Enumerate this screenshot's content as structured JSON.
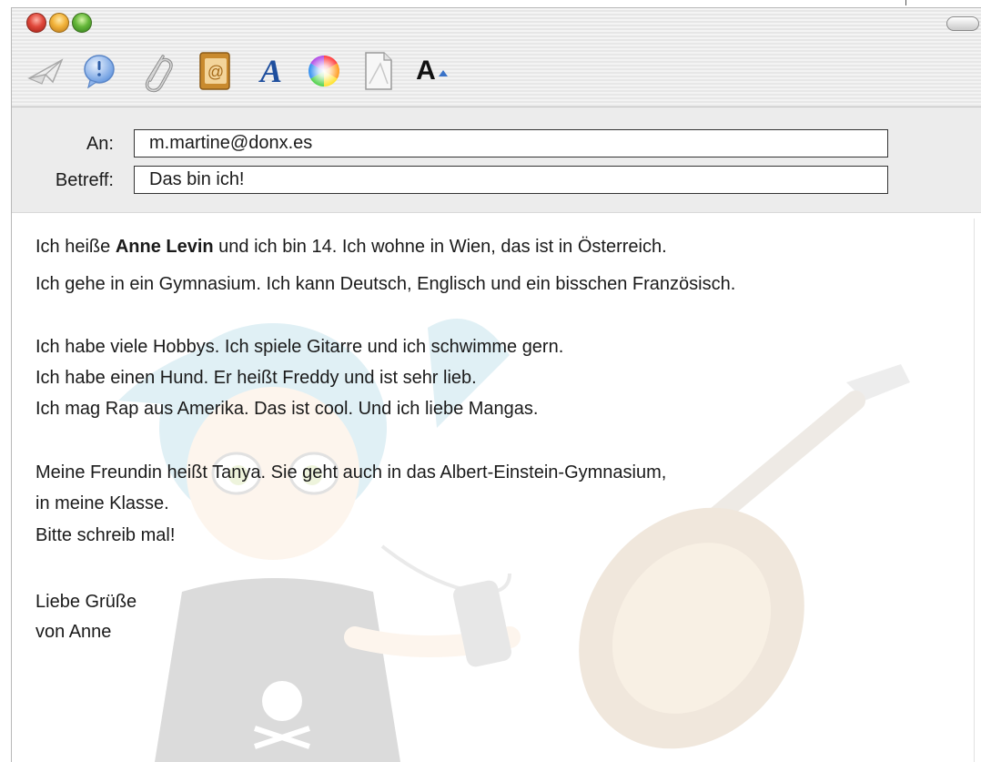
{
  "window": {
    "buttons": [
      "close",
      "minimize",
      "zoom"
    ]
  },
  "toolbar": {
    "icons": [
      "send-icon",
      "chat-bubble-icon",
      "paperclip-icon",
      "address-book-icon",
      "font-icon",
      "color-wheel-icon",
      "document-icon",
      "font-size-icon"
    ],
    "font_glyph": "A",
    "font_size_glyph": "A"
  },
  "header": {
    "to_label": "An:",
    "to_value": "m.martine@donx.es",
    "subject_label": "Betreff:",
    "subject_value": "Das bin ich!"
  },
  "message": {
    "line1_pre": "Ich heiße ",
    "line1_name": "Anne Levin",
    "line1_post": " und ich bin 14. Ich wohne in Wien, das ist in Österreich.",
    "line2": "Ich gehe in ein Gymnasium. Ich kann Deutsch, Englisch und ein bisschen Französisch.",
    "line3": "Ich habe viele Hobbys. Ich spiele Gitarre und ich schwimme gern.",
    "line4": "Ich habe einen Hund. Er heißt Freddy und ist sehr lieb.",
    "line5": "Ich mag Rap aus Amerika. Das ist cool. Und ich liebe Mangas.",
    "line6": "Meine Freundin heißt Tanya. Sie geht auch in das Albert-Einstein-Gymnasium,",
    "line7": "in meine Klasse.",
    "line8": "Bitte schreib mal!",
    "line9": "Liebe Grüße",
    "line10": "von Anne"
  },
  "colors": {
    "close": "#e0483b",
    "minimize": "#f2b33a",
    "zoom": "#66b83a",
    "fields_bg": "#ececec"
  }
}
